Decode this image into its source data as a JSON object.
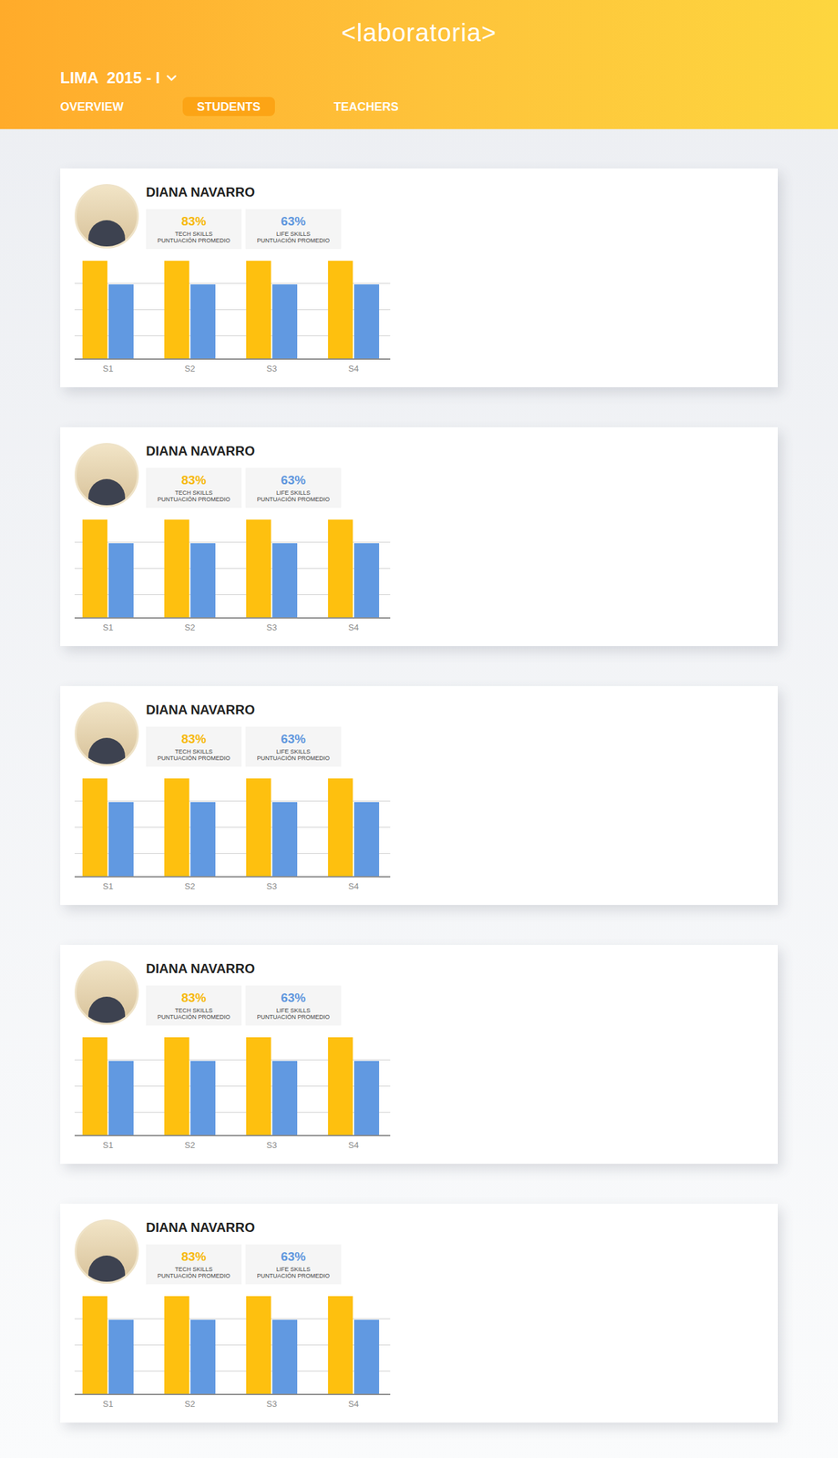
{
  "header": {
    "logo": "<laboratoria>",
    "cohort": "LIMA  2015 - I"
  },
  "tabs": [
    {
      "label": "OVERVIEW",
      "selected": false
    },
    {
      "label": "STUDENTS",
      "selected": true
    },
    {
      "label": "TEACHERS",
      "selected": false
    }
  ],
  "students": [
    {
      "name": "DIANA NAVARRO",
      "stats": [
        {
          "value": "83%",
          "label": "TECH SKILLS",
          "sublabel": "PUNTUACIÓN PROMEDIO",
          "color": "#f7b90c"
        },
        {
          "value": "63%",
          "label": "LIFE SKILLS",
          "sublabel": "PUNTUACIÓN PROMEDIO",
          "color": "#5f97de"
        }
      ],
      "chart": {
        "labels": [
          "S1",
          "S2",
          "S3",
          "S4"
        ],
        "series": [
          {
            "color": "#fec00f",
            "values": [
              83,
              83,
              83,
              83
            ]
          },
          {
            "color": "#6199e1",
            "values": [
              63,
              63,
              63,
              63
            ]
          }
        ]
      }
    },
    {
      "name": "DIANA NAVARRO",
      "stats": [
        {
          "value": "83%",
          "label": "TECH SKILLS",
          "sublabel": "PUNTUACIÓN PROMEDIO",
          "color": "#f7b90c"
        },
        {
          "value": "63%",
          "label": "LIFE SKILLS",
          "sublabel": "PUNTUACIÓN PROMEDIO",
          "color": "#5f97de"
        }
      ],
      "chart": {
        "labels": [
          "S1",
          "S2",
          "S3",
          "S4"
        ],
        "series": [
          {
            "color": "#fec00f",
            "values": [
              83,
              83,
              83,
              83
            ]
          },
          {
            "color": "#6199e1",
            "values": [
              63,
              63,
              63,
              63
            ]
          }
        ]
      }
    },
    {
      "name": "DIANA NAVARRO",
      "stats": [
        {
          "value": "83%",
          "label": "TECH SKILLS",
          "sublabel": "PUNTUACIÓN PROMEDIO",
          "color": "#f7b90c"
        },
        {
          "value": "63%",
          "label": "LIFE SKILLS",
          "sublabel": "PUNTUACIÓN PROMEDIO",
          "color": "#5f97de"
        }
      ],
      "chart": {
        "labels": [
          "S1",
          "S2",
          "S3",
          "S4"
        ],
        "series": [
          {
            "color": "#fec00f",
            "values": [
              83,
              83,
              83,
              83
            ]
          },
          {
            "color": "#6199e1",
            "values": [
              63,
              63,
              63,
              63
            ]
          }
        ]
      }
    },
    {
      "name": "DIANA NAVARRO",
      "stats": [
        {
          "value": "83%",
          "label": "TECH SKILLS",
          "sublabel": "PUNTUACIÓN PROMEDIO",
          "color": "#f7b90c"
        },
        {
          "value": "63%",
          "label": "LIFE SKILLS",
          "sublabel": "PUNTUACIÓN PROMEDIO",
          "color": "#5f97de"
        }
      ],
      "chart": {
        "labels": [
          "S1",
          "S2",
          "S3",
          "S4"
        ],
        "series": [
          {
            "color": "#fec00f",
            "values": [
              83,
              83,
              83,
              83
            ]
          },
          {
            "color": "#6199e1",
            "values": [
              63,
              63,
              63,
              63
            ]
          }
        ]
      }
    },
    {
      "name": "DIANA NAVARRO",
      "stats": [
        {
          "value": "83%",
          "label": "TECH SKILLS",
          "sublabel": "PUNTUACIÓN PROMEDIO",
          "color": "#f7b90c"
        },
        {
          "value": "63%",
          "label": "LIFE SKILLS",
          "sublabel": "PUNTUACIÓN PROMEDIO",
          "color": "#5f97de"
        }
      ],
      "chart": {
        "labels": [
          "S1",
          "S2",
          "S3",
          "S4"
        ],
        "series": [
          {
            "color": "#fec00f",
            "values": [
              83,
              83,
              83,
              83
            ]
          },
          {
            "color": "#6199e1",
            "values": [
              63,
              63,
              63,
              63
            ]
          }
        ]
      }
    }
  ]
}
